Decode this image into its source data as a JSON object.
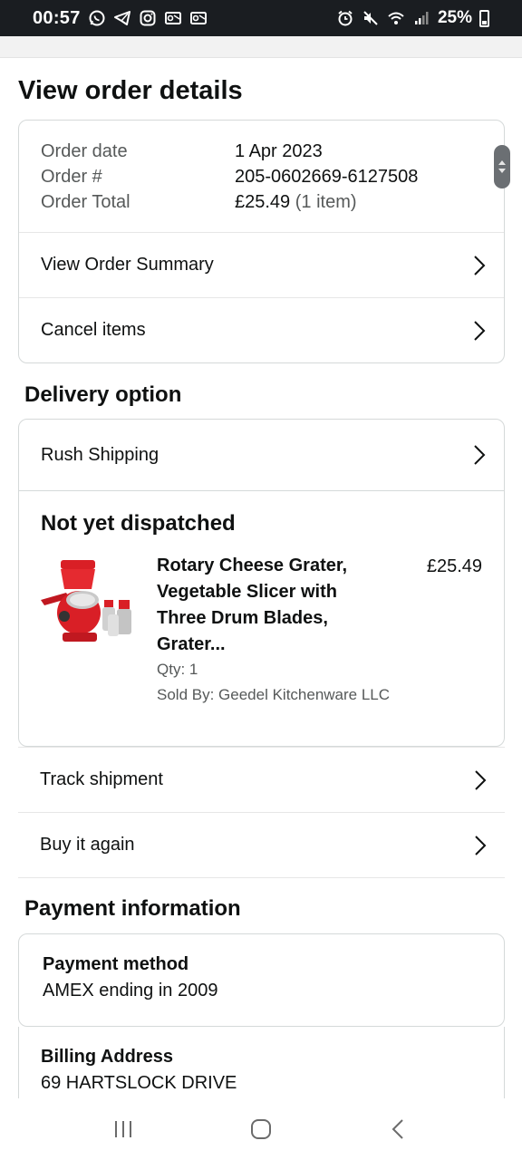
{
  "status_bar": {
    "time": "00:57",
    "battery": "25%",
    "left_icons": [
      "whatsapp-icon",
      "telegram-icon",
      "instagram-icon",
      "outlook-icon",
      "outlook-icon"
    ],
    "right_icons": [
      "alarm-icon",
      "mute-icon",
      "wifi-icon",
      "signal-icon"
    ]
  },
  "page": {
    "title": "View order details"
  },
  "order": {
    "labels": {
      "date": "Order date",
      "number": "Order #",
      "total": "Order Total"
    },
    "date": "1 Apr 2023",
    "number": "205-0602669-6127508",
    "total": "£25.49",
    "item_count": "(1 item)",
    "actions": {
      "summary": "View Order Summary",
      "cancel": "Cancel items"
    }
  },
  "delivery": {
    "section_title": "Delivery option",
    "option": "Rush Shipping",
    "status": "Not yet dispatched",
    "product": {
      "title": "Rotary Cheese Grater, Vegetable Slicer with Three Drum Blades, Grater...",
      "price": "£25.49",
      "qty": "Qty: 1",
      "seller": "Sold By: Geedel Kitchenware LLC",
      "image_color": "#d91f26"
    },
    "actions": {
      "track": "Track shipment",
      "buy_again": "Buy it again"
    }
  },
  "payment": {
    "section_title": "Payment information",
    "method_label": "Payment method",
    "method_value": "AMEX  ending in 2009",
    "billing_label": "Billing Address",
    "billing_value": "69 HARTSLOCK DRIVE"
  },
  "nav_bar": {
    "icons": [
      "recent-apps-icon",
      "home-icon",
      "back-icon"
    ]
  }
}
